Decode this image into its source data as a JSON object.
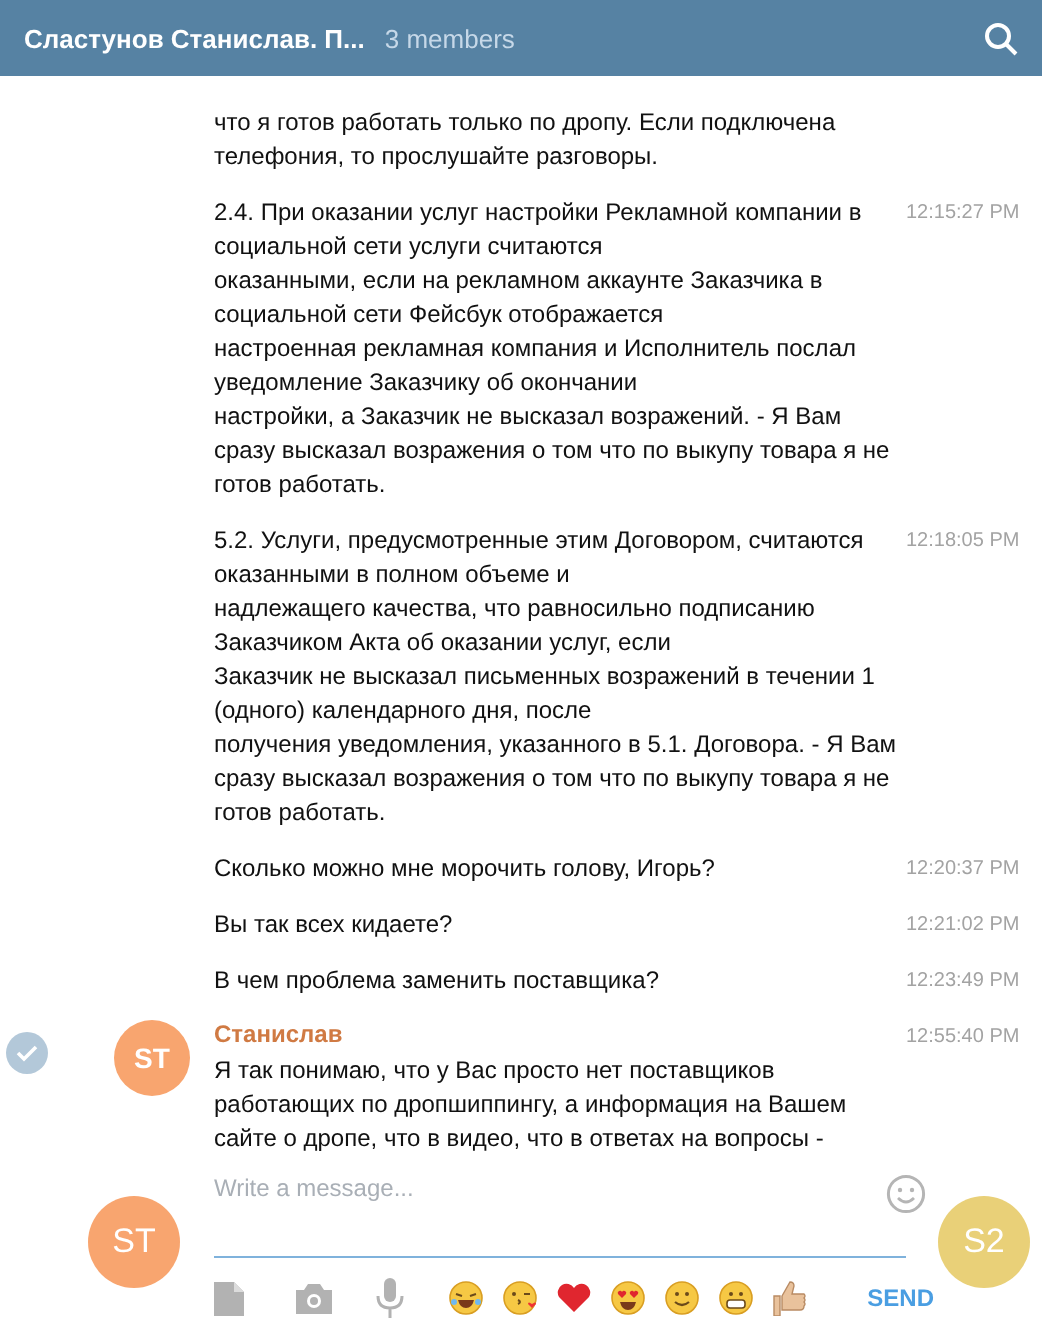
{
  "header": {
    "title": "Сластунов Станислав. П...",
    "subtitle": "3 members"
  },
  "messages": [
    {
      "text": "что я готов работать только по дропу. Если подключена\nтелефония, то прослушайте разговоры."
    },
    {
      "text": "2.4. При оказании услуг настройки Рекламной компании в\nсоциальной сети услуги считаются\nоказанными, если на рекламном аккаунте Заказчика в\nсоциальной сети Фейсбук отображается\nнастроенная рекламная компания и Исполнитель послал\nуведомление Заказчику об окончании\nнастройки, а Заказчик не высказал возражений. - Я Вам\nсразу высказал возражения о том что по выкупу товара я не\nготов работать.",
      "time": "12:15:27 PM"
    },
    {
      "text": "5.2. Услуги, предусмотренные этим Договором, считаются\nоказанными в полном объеме и\nнадлежащего качества, что равносильно подписанию\nЗаказчиком Акта об оказании услуг, если\nЗаказчик не высказал письменных возражений в течении 1\n(одного) календарного дня, после\nполучения уведомления, указанного в 5.1. Договора. - Я Вам\nсразу высказал возражения о том что по выкупу товара я не\nготов работать.",
      "time": "12:18:05 PM"
    },
    {
      "text": "Сколько можно мне морочить голову, Игорь?",
      "time": "12:20:37 PM"
    },
    {
      "text": "Вы так всех кидаете?",
      "time": "12:21:02 PM"
    },
    {
      "text": "В чем проблема заменить поставщика?",
      "time": "12:23:49 PM"
    },
    {
      "author": "Станислав",
      "avatar": "ST",
      "text": "Я так понимаю, что у Вас просто нет поставщиков\nработающих по дропшиппингу, а информация на Вашем\nсайте о дропе, что в видео, что в ответах на вопросы -",
      "time": "12:55:40 PM"
    }
  ],
  "composer": {
    "my_avatar": "ST",
    "placeholder": "Write a message...",
    "peer_avatar": "S2",
    "send": "SEND"
  }
}
